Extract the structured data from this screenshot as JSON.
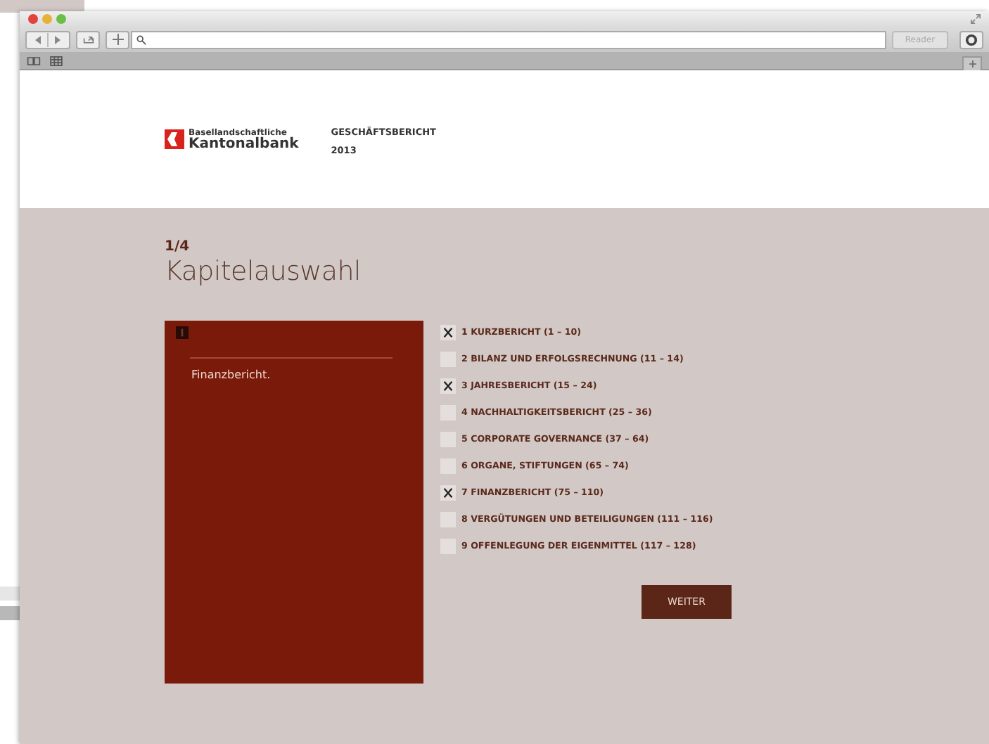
{
  "browser": {
    "reader_button": "Reader"
  },
  "header": {
    "bank_name_top": "Basellandschaftliche",
    "bank_name": "Kantonalbank",
    "report_title": "GESCHÄFTSBERICHT",
    "report_year": "2013"
  },
  "step": "1/4",
  "heading": "Kapitelauswahl",
  "panel": {
    "text": "Finanzbericht."
  },
  "chapters": [
    {
      "label": "1 KURZBERICHT (1 – 10)",
      "checked": true
    },
    {
      "label": "2 BILANZ UND ERFOLGSRECHNUNG (11 – 14)",
      "checked": false
    },
    {
      "label": "3 JAHRESBERICHT (15 – 24)",
      "checked": true
    },
    {
      "label": "4 NACHHALTIGKEITSBERICHT (25 – 36)",
      "checked": false
    },
    {
      "label": "5 CORPORATE GOVERNANCE (37 – 64)",
      "checked": false
    },
    {
      "label": "6 ORGANE, STIFTUNGEN (65 – 74)",
      "checked": false
    },
    {
      "label": "7 FINANZBERICHT (75 – 110)",
      "checked": true
    },
    {
      "label": "8 VERGÜTUNGEN UND BETEILIGUNGEN (111 – 116)",
      "checked": false
    },
    {
      "label": "9 OFFENLEGUNG DER EIGENMITTEL (117 – 128)",
      "checked": false
    }
  ],
  "next_button": "WEITER"
}
